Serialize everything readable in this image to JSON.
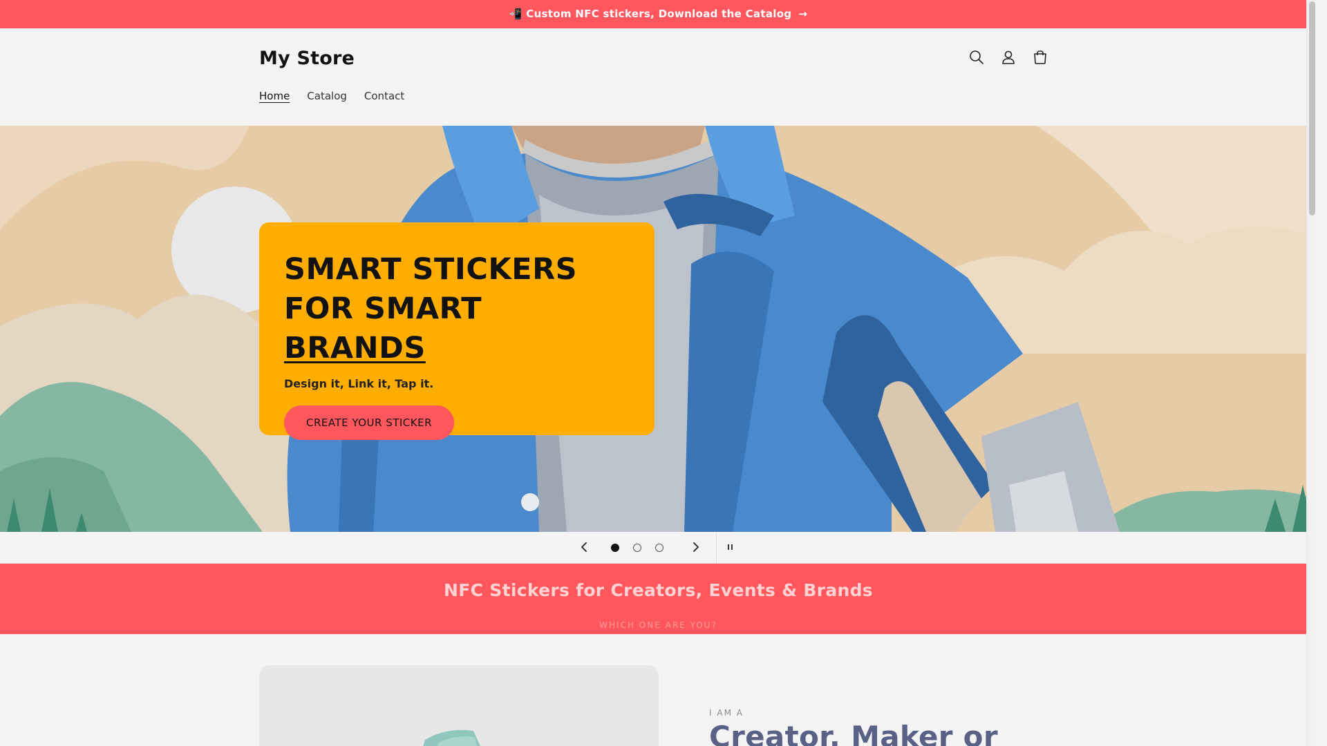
{
  "announcement": {
    "text": "📲 Custom NFC stickers, Download the Catalog",
    "arrow": "→"
  },
  "header": {
    "logo": "My Store",
    "nav": [
      {
        "label": "Home",
        "active": true
      },
      {
        "label": "Catalog",
        "active": false
      },
      {
        "label": "Contact",
        "active": false
      }
    ],
    "icons": [
      "search-icon",
      "account-icon",
      "cart-icon"
    ]
  },
  "hero": {
    "title_line1": "SMART STICKERS",
    "title_line2_prefix": "FOR SMART ",
    "title_line2_underlined": "BRANDS",
    "subtitle": "Design it, Link it, Tap it.",
    "button_label": "CREATE YOUR STICKER",
    "card_color": "#ffad00",
    "button_color": "#ff575d"
  },
  "slider": {
    "slides_total": 3,
    "current_slide": 1,
    "controls": [
      "chevron-left-icon",
      "chevron-right-icon",
      "pause-icon"
    ]
  },
  "band": {
    "title": "NFC Stickers for Creators, Events & Brands",
    "subtitle": "WHICH ONE ARE YOU?",
    "color": "#ff575d"
  },
  "feature": {
    "kicker": "I AM A",
    "heading": "Creator, Maker or"
  },
  "colors": {
    "accent": "#ff575d",
    "text": "#121212",
    "background": "#f4f4f4"
  }
}
